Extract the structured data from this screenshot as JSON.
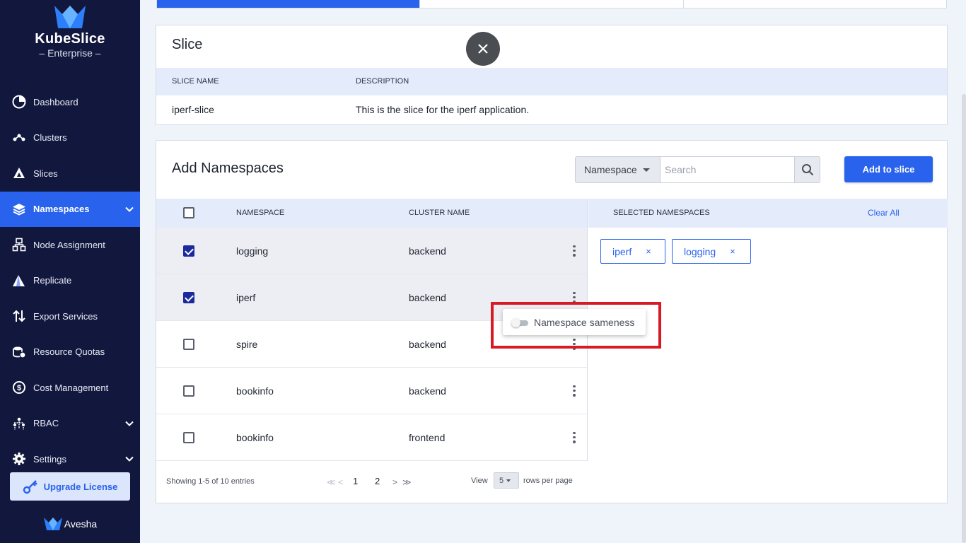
{
  "brand": {
    "name": "KubeSlice",
    "edition": "Enterprise",
    "footer": "Avesha"
  },
  "sidebar": {
    "items": [
      {
        "label": "Dashboard",
        "icon": "dashboard-pie-icon"
      },
      {
        "label": "Clusters",
        "icon": "clusters-icon"
      },
      {
        "label": "Slices",
        "icon": "slices-icon"
      },
      {
        "label": "Namespaces",
        "icon": "namespaces-layers-icon",
        "active": true,
        "expandable": true
      },
      {
        "label": "Node Assignment",
        "icon": "node-assignment-icon"
      },
      {
        "label": "Replicate",
        "icon": "replicate-icon"
      },
      {
        "label": "Export Services",
        "icon": "export-services-icon"
      },
      {
        "label": "Resource Quotas",
        "icon": "resource-quotas-icon"
      },
      {
        "label": "Cost Management",
        "icon": "cost-management-icon"
      },
      {
        "label": "RBAC",
        "icon": "rbac-icon",
        "expandable": true
      },
      {
        "label": "Settings",
        "icon": "settings-gear-icon",
        "expandable": true
      }
    ],
    "upgrade_label": "Upgrade License"
  },
  "slice_card": {
    "title": "Slice",
    "columns": [
      "SLICE NAME",
      "DESCRIPTION"
    ],
    "row": {
      "name": "iperf-slice",
      "description": "This is the slice for the iperf application."
    }
  },
  "namespaces_card": {
    "title": "Add Namespaces",
    "filter_type": "Namespace",
    "search_placeholder": "Search",
    "add_button": "Add to slice",
    "columns": [
      "NAMESPACE",
      "CLUSTER NAME"
    ],
    "rows": [
      {
        "namespace": "logging",
        "cluster": "backend",
        "checked": true
      },
      {
        "namespace": "iperf",
        "cluster": "backend",
        "checked": true
      },
      {
        "namespace": "spire",
        "cluster": "backend",
        "checked": false
      },
      {
        "namespace": "bookinfo",
        "cluster": "backend",
        "checked": false
      },
      {
        "namespace": "bookinfo",
        "cluster": "frontend",
        "checked": false
      }
    ],
    "selected_header": "SELECTED NAMESPACES",
    "clear_all": "Clear All",
    "selected_chips": [
      "iperf",
      "logging"
    ],
    "chip_remove": "×",
    "pagination": {
      "showing": "Showing 1-5 of 10 entries",
      "first": "≪",
      "prev": "<",
      "pages": [
        "1",
        "2"
      ],
      "next": ">",
      "last": "≫",
      "view_label": "View",
      "rows_per_page": "5",
      "rows_per_page_label": "rows per page"
    }
  },
  "row_menu": {
    "toggle_label": "Namespace sameness",
    "toggle_on": false
  },
  "colors": {
    "sidebar_bg": "#12183d",
    "accent": "#2962ec",
    "highlight": "#d71b26"
  }
}
